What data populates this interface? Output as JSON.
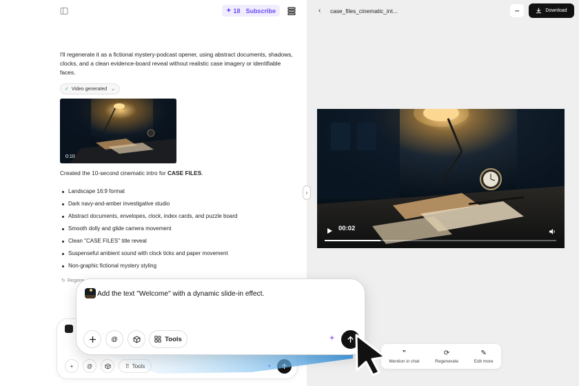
{
  "chat": {
    "credits": "18",
    "subscribe_label": "Subscribe",
    "assistant_message": "I'll regenerate it as a fictional mystery-podcast opener, using abstract documents, shadows, clocks, and a clean evidence-board reveal without realistic case imagery or identifiable faces.",
    "video_chip_label": "Video generated",
    "thumbnail_duration": "0:10",
    "created_prefix": "Created the 10-second cinematic intro for ",
    "created_bold": "CASE FILES",
    "created_suffix": ".",
    "bullets": [
      "Landscape 16:9 format",
      "Dark navy-and-amber investigative studio",
      "Abstract documents, envelopes, clock, index cards, and puzzle board",
      "Smooth dolly and glide camera movement",
      "Clean \"CASE FILES\" title reveal",
      "Suspenseful ambient sound with clock ticks and paper movement",
      "Non-graphic fictional mystery styling"
    ],
    "regenerate_partial": "Regene",
    "small_composer": {
      "tools_label": "Tools",
      "at_label": "@"
    }
  },
  "preview": {
    "file_title": "case_files_cinematic_int...",
    "more_label": "···",
    "download_label": "Download",
    "player_time": "00:02",
    "progress_fraction": 0.24
  },
  "action_bar": {
    "mention_label": "Mention in chat",
    "regenerate_label": "Regenerate",
    "edit_label": "Edit more"
  },
  "composer": {
    "prompt_text": "Add the text \"Welcome\" with a dynamic slide-in effect.",
    "at_label": "@",
    "tools_label": "Tools"
  },
  "colors": {
    "accent": "#6d4df2",
    "credits_bg": "#f1edff",
    "send_button": "#111111",
    "preview_bg": "#efefef",
    "beam": "#4aa3e8"
  }
}
